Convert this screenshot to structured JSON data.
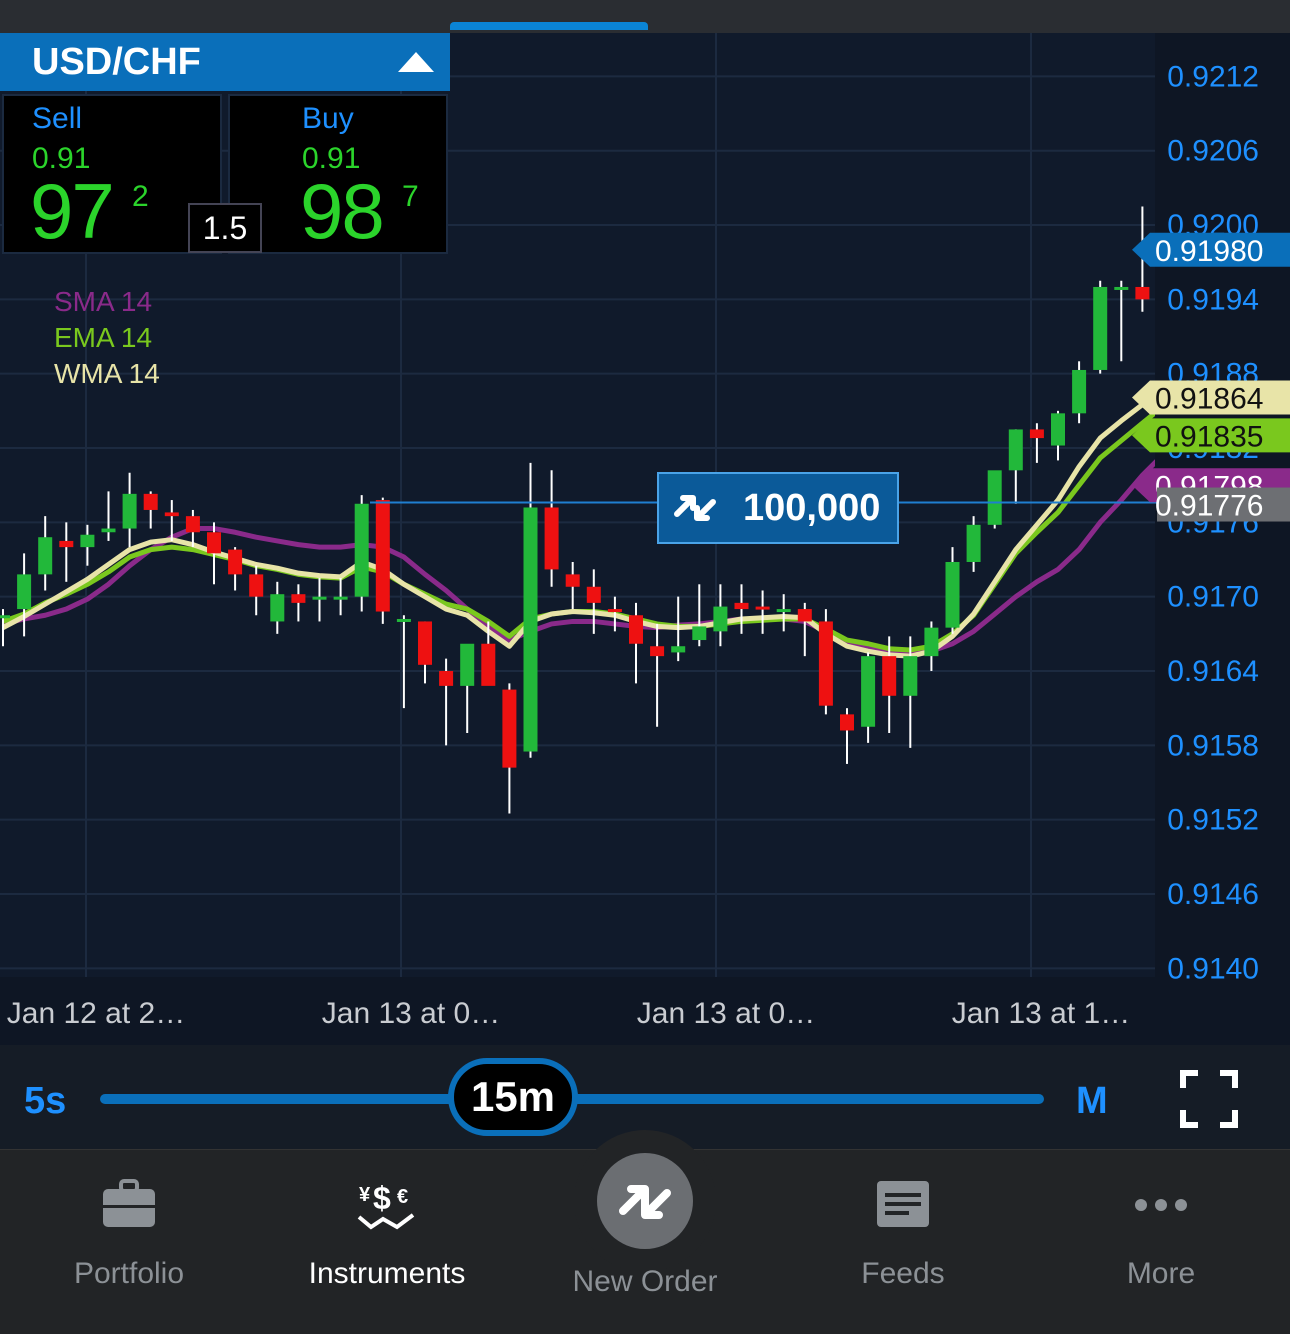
{
  "instrument": {
    "symbol": "USD/CHF"
  },
  "sell": {
    "label": "Sell",
    "prefix": "0.91",
    "big": "97",
    "sup": "2"
  },
  "buy": {
    "label": "Buy",
    "prefix": "0.91",
    "big": "98",
    "sup": "7"
  },
  "spread": "1.5",
  "indicators": [
    {
      "name": "SMA 14",
      "color": "#8a2a8a"
    },
    {
      "name": "EMA 14",
      "color": "#7ac81e"
    },
    {
      "name": "WMA 14",
      "color": "#e8e4a8"
    }
  ],
  "position": {
    "quantity": "100,000",
    "price": 0.91776
  },
  "colors": {
    "accent": "#0a6fba",
    "up": "#22b83a",
    "down": "#ee1111",
    "background": "#101a2b"
  },
  "chart_data": {
    "type": "candlestick",
    "ylim": [
      0.91393,
      0.92155
    ],
    "yticks": [
      "0.9212",
      "0.9206",
      "0.9200",
      "0.9194",
      "0.9188",
      "0.9182",
      "0.9176",
      "0.9170",
      "0.9164",
      "0.9158",
      "0.9152",
      "0.9146",
      "0.9140"
    ],
    "xticks": [
      "Jan 12 at 2…",
      "Jan 13 at 0…",
      "Jan 13 at 0…",
      "Jan 13 at 1…"
    ],
    "price_tags": [
      {
        "label": "0.91980",
        "value": 0.9198,
        "bg": "#0a6fba",
        "fg": "#ffffff"
      },
      {
        "label": "0.91864",
        "value": 0.91864,
        "bg": "#e8e4a8",
        "fg": "#111111"
      },
      {
        "label": "0.91835",
        "value": 0.91835,
        "bg": "#7ac81e",
        "fg": "#111111"
      },
      {
        "label": "0.91798",
        "value": 0.91798,
        "bg": "#8a2a8a",
        "fg": "#ffffff"
      },
      {
        "label": "0.91776",
        "value": 0.91776,
        "bg": "#6d6f73",
        "fg": "#ffffff"
      }
    ],
    "candles": [
      {
        "o": 0.91685,
        "h": 0.9169,
        "l": 0.9166,
        "c": 0.91685
      },
      {
        "o": 0.9169,
        "h": 0.91735,
        "l": 0.91668,
        "c": 0.91718
      },
      {
        "o": 0.91718,
        "h": 0.91765,
        "l": 0.91705,
        "c": 0.91748
      },
      {
        "o": 0.91745,
        "h": 0.9176,
        "l": 0.91712,
        "c": 0.9174
      },
      {
        "o": 0.9174,
        "h": 0.91758,
        "l": 0.91725,
        "c": 0.9175
      },
      {
        "o": 0.91752,
        "h": 0.91785,
        "l": 0.91745,
        "c": 0.91755
      },
      {
        "o": 0.91755,
        "h": 0.918,
        "l": 0.9174,
        "c": 0.91783
      },
      {
        "o": 0.91783,
        "h": 0.91785,
        "l": 0.91755,
        "c": 0.9177
      },
      {
        "o": 0.91768,
        "h": 0.91778,
        "l": 0.91745,
        "c": 0.91765
      },
      {
        "o": 0.91765,
        "h": 0.9177,
        "l": 0.9174,
        "c": 0.91752
      },
      {
        "o": 0.91752,
        "h": 0.9176,
        "l": 0.9171,
        "c": 0.91735
      },
      {
        "o": 0.91738,
        "h": 0.9174,
        "l": 0.91705,
        "c": 0.91718
      },
      {
        "o": 0.91718,
        "h": 0.91725,
        "l": 0.91685,
        "c": 0.917
      },
      {
        "o": 0.9168,
        "h": 0.91712,
        "l": 0.9167,
        "c": 0.91702
      },
      {
        "o": 0.91702,
        "h": 0.9171,
        "l": 0.9168,
        "c": 0.91695
      },
      {
        "o": 0.917,
        "h": 0.91715,
        "l": 0.9168,
        "c": 0.917
      },
      {
        "o": 0.917,
        "h": 0.91715,
        "l": 0.91685,
        "c": 0.917
      },
      {
        "o": 0.917,
        "h": 0.91782,
        "l": 0.91688,
        "c": 0.91775
      },
      {
        "o": 0.91778,
        "h": 0.9178,
        "l": 0.91678,
        "c": 0.91688
      },
      {
        "o": 0.9168,
        "h": 0.91685,
        "l": 0.9161,
        "c": 0.91682
      },
      {
        "o": 0.9168,
        "h": 0.9168,
        "l": 0.9163,
        "c": 0.91645
      },
      {
        "o": 0.9164,
        "h": 0.9165,
        "l": 0.9158,
        "c": 0.91628
      },
      {
        "o": 0.91628,
        "h": 0.9166,
        "l": 0.9159,
        "c": 0.91662
      },
      {
        "o": 0.91662,
        "h": 0.9168,
        "l": 0.9163,
        "c": 0.91628
      },
      {
        "o": 0.91625,
        "h": 0.9163,
        "l": 0.91525,
        "c": 0.91562
      },
      {
        "o": 0.91575,
        "h": 0.91808,
        "l": 0.9157,
        "c": 0.91772
      },
      {
        "o": 0.91772,
        "h": 0.91802,
        "l": 0.91708,
        "c": 0.91722
      },
      {
        "o": 0.91718,
        "h": 0.91728,
        "l": 0.9169,
        "c": 0.91708
      },
      {
        "o": 0.91708,
        "h": 0.91722,
        "l": 0.9167,
        "c": 0.91695
      },
      {
        "o": 0.9169,
        "h": 0.917,
        "l": 0.91672,
        "c": 0.91688
      },
      {
        "o": 0.91685,
        "h": 0.91695,
        "l": 0.9163,
        "c": 0.91662
      },
      {
        "o": 0.9166,
        "h": 0.91678,
        "l": 0.91595,
        "c": 0.91652
      },
      {
        "o": 0.91655,
        "h": 0.917,
        "l": 0.91648,
        "c": 0.9166
      },
      {
        "o": 0.91665,
        "h": 0.9171,
        "l": 0.9166,
        "c": 0.91676
      },
      {
        "o": 0.91672,
        "h": 0.9171,
        "l": 0.9166,
        "c": 0.91692
      },
      {
        "o": 0.91695,
        "h": 0.9171,
        "l": 0.9167,
        "c": 0.9169
      },
      {
        "o": 0.91692,
        "h": 0.91705,
        "l": 0.9167,
        "c": 0.9169
      },
      {
        "o": 0.91688,
        "h": 0.91702,
        "l": 0.91672,
        "c": 0.9169
      },
      {
        "o": 0.9169,
        "h": 0.91695,
        "l": 0.91652,
        "c": 0.9168
      },
      {
        "o": 0.9168,
        "h": 0.9169,
        "l": 0.91605,
        "c": 0.91612
      },
      {
        "o": 0.91605,
        "h": 0.9161,
        "l": 0.91565,
        "c": 0.91592
      },
      {
        "o": 0.91595,
        "h": 0.91655,
        "l": 0.91582,
        "c": 0.91652
      },
      {
        "o": 0.91652,
        "h": 0.91668,
        "l": 0.9159,
        "c": 0.9162
      },
      {
        "o": 0.9162,
        "h": 0.91668,
        "l": 0.91578,
        "c": 0.91652
      },
      {
        "o": 0.91652,
        "h": 0.9168,
        "l": 0.9164,
        "c": 0.91675
      },
      {
        "o": 0.91675,
        "h": 0.9174,
        "l": 0.9167,
        "c": 0.91728
      },
      {
        "o": 0.91728,
        "h": 0.91765,
        "l": 0.9172,
        "c": 0.91758
      },
      {
        "o": 0.91758,
        "h": 0.918,
        "l": 0.91755,
        "c": 0.91802
      },
      {
        "o": 0.91802,
        "h": 0.91835,
        "l": 0.91775,
        "c": 0.91835
      },
      {
        "o": 0.91835,
        "h": 0.9184,
        "l": 0.91808,
        "c": 0.91828
      },
      {
        "o": 0.91822,
        "h": 0.9185,
        "l": 0.9181,
        "c": 0.91848
      },
      {
        "o": 0.91848,
        "h": 0.9189,
        "l": 0.9184,
        "c": 0.91883
      },
      {
        "o": 0.91883,
        "h": 0.91955,
        "l": 0.9188,
        "c": 0.9195
      },
      {
        "o": 0.9195,
        "h": 0.91955,
        "l": 0.9189,
        "c": 0.9195
      },
      {
        "o": 0.9195,
        "h": 0.92015,
        "l": 0.9193,
        "c": 0.9194
      },
      {
        "o": 0.9194,
        "h": 0.91988,
        "l": 0.91937,
        "c": 0.9198
      }
    ],
    "sma": [
      0.91678,
      0.91682,
      0.91685,
      0.9169,
      0.91698,
      0.9171,
      0.91725,
      0.91738,
      0.91748,
      0.91755,
      0.91755,
      0.91752,
      0.91748,
      0.91745,
      0.91742,
      0.9174,
      0.9174,
      0.91742,
      0.9174,
      0.91732,
      0.91718,
      0.91705,
      0.9169,
      0.91675,
      0.91665,
      0.91672,
      0.91678,
      0.9168,
      0.9168,
      0.91678,
      0.91676,
      0.91675,
      0.91677,
      0.91678,
      0.9168,
      0.91682,
      0.91682,
      0.91682,
      0.9168,
      0.91672,
      0.91664,
      0.9166,
      0.91656,
      0.91655,
      0.91656,
      0.91662,
      0.91672,
      0.91686,
      0.917,
      0.91712,
      0.91722,
      0.91738,
      0.9176,
      0.91778,
      0.91798,
      0.91815
    ],
    "ema": [
      0.9168,
      0.91686,
      0.91695,
      0.91702,
      0.9171,
      0.9172,
      0.91732,
      0.91738,
      0.9174,
      0.91738,
      0.91734,
      0.9173,
      0.91725,
      0.91722,
      0.91718,
      0.91716,
      0.91715,
      0.91724,
      0.9172,
      0.9171,
      0.91702,
      0.91694,
      0.9169,
      0.9168,
      0.91668,
      0.91682,
      0.91686,
      0.91688,
      0.91688,
      0.91686,
      0.91682,
      0.91678,
      0.91676,
      0.91676,
      0.91678,
      0.9168,
      0.91681,
      0.91682,
      0.91682,
      0.91674,
      0.91665,
      0.91662,
      0.91658,
      0.91657,
      0.9166,
      0.9167,
      0.91685,
      0.9171,
      0.91735,
      0.91752,
      0.91768,
      0.9179,
      0.91812,
      0.91826,
      0.9184,
      0.91854
    ],
    "wma": [
      0.91675,
      0.91684,
      0.91694,
      0.91704,
      0.91714,
      0.91726,
      0.91738,
      0.91744,
      0.91746,
      0.91742,
      0.91736,
      0.91731,
      0.91726,
      0.91723,
      0.91719,
      0.91717,
      0.91716,
      0.91728,
      0.91722,
      0.9171,
      0.917,
      0.9169,
      0.91685,
      0.91672,
      0.9166,
      0.9168,
      0.91686,
      0.91688,
      0.91687,
      0.91685,
      0.9168,
      0.91676,
      0.91675,
      0.91676,
      0.91679,
      0.91682,
      0.91683,
      0.91684,
      0.91683,
      0.9167,
      0.9166,
      0.91656,
      0.91653,
      0.91652,
      0.91656,
      0.91668,
      0.91686,
      0.91712,
      0.91738,
      0.91758,
      0.91778,
      0.91805,
      0.91828,
      0.91842,
      0.91855,
      0.91868
    ]
  },
  "timeframe": {
    "min_label": "5s",
    "selected": "15m",
    "max_label": "M"
  },
  "tabs": [
    {
      "label": "Portfolio",
      "icon": "briefcase-icon"
    },
    {
      "label": "Instruments",
      "icon": "currency-icon",
      "active": true
    },
    {
      "label": "New Order",
      "icon": "new-order-arrows-icon"
    },
    {
      "label": "Feeds",
      "icon": "feeds-icon"
    },
    {
      "label": "More",
      "icon": "more-dots-icon"
    }
  ]
}
